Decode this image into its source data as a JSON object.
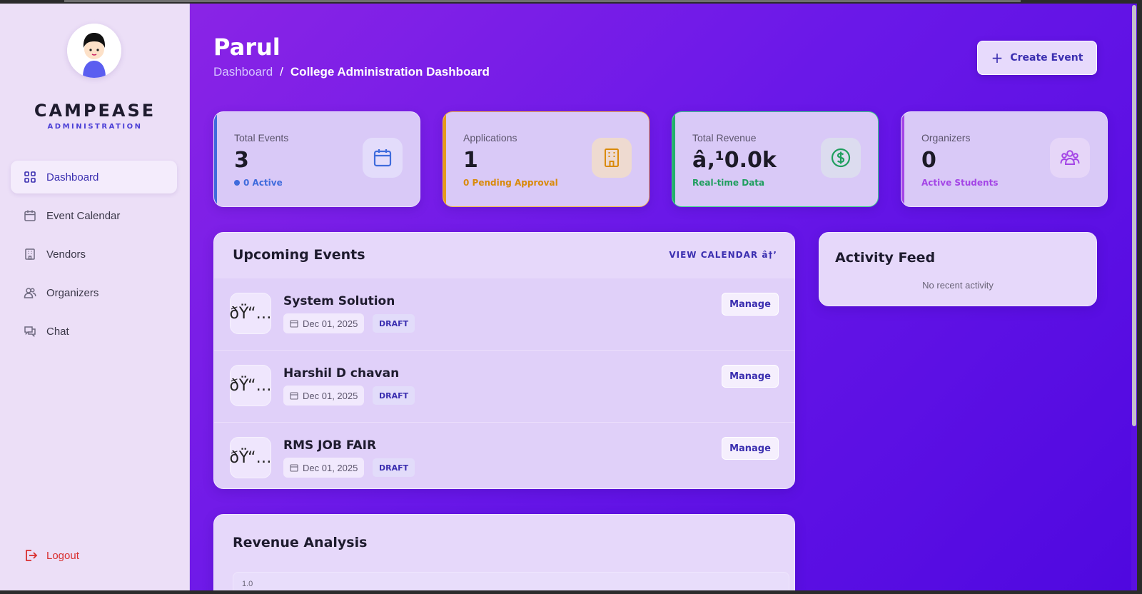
{
  "sidebar": {
    "brand": "CAMPEASE",
    "brand_sub": "ADMINISTRATION",
    "items": [
      {
        "label": "Dashboard",
        "icon": "grid-icon",
        "active": true
      },
      {
        "label": "Event Calendar",
        "icon": "calendar-icon"
      },
      {
        "label": "Vendors",
        "icon": "building-icon"
      },
      {
        "label": "Organizers",
        "icon": "users-icon"
      },
      {
        "label": "Chat",
        "icon": "chat-icon"
      }
    ],
    "logout_label": "Logout"
  },
  "header": {
    "title": "Parul",
    "breadcrumb": [
      "Dashboard",
      "/",
      "College Administration Dashboard"
    ],
    "create_button": "Create Event"
  },
  "stats": [
    {
      "label": "Total Events",
      "value": "3",
      "sub": "0 Active",
      "icon": "calendar-icon",
      "accent": "#3f6bdc"
    },
    {
      "label": "Applications",
      "value": "1",
      "sub": "0 Pending Approval",
      "icon": "building-icon",
      "accent": "#e59a1a"
    },
    {
      "label": "Total Revenue",
      "value": "â‚¹0.0k",
      "sub": "Real-time Data",
      "icon": "dollar-icon",
      "accent": "#23b06b"
    },
    {
      "label": "Organizers",
      "value": "0",
      "sub": "Active Students",
      "icon": "users-icon",
      "accent": "#a445e6"
    }
  ],
  "upcoming": {
    "title": "Upcoming Events",
    "view_link": "VIEW CALENDAR â†’",
    "events": [
      {
        "thumb": "ðŸ“…",
        "name": "System Solution",
        "date": "Dec 01, 2025",
        "status": "DRAFT",
        "action": "Manage"
      },
      {
        "thumb": "ðŸ“…",
        "name": "Harshil D chavan",
        "date": "Dec 01, 2025",
        "status": "DRAFT",
        "action": "Manage"
      },
      {
        "thumb": "ðŸ“…",
        "name": "RMS JOB FAIR",
        "date": "Dec 01, 2025",
        "status": "DRAFT",
        "action": "Manage"
      }
    ]
  },
  "activity": {
    "title": "Activity Feed",
    "empty": "No recent activity"
  },
  "revenue": {
    "title": "Revenue Analysis",
    "tick": "1.0"
  },
  "colors": {
    "sidebar_bg": "#ecdff7",
    "primary": "#3b2fb0",
    "logout": "#d92f2f"
  }
}
